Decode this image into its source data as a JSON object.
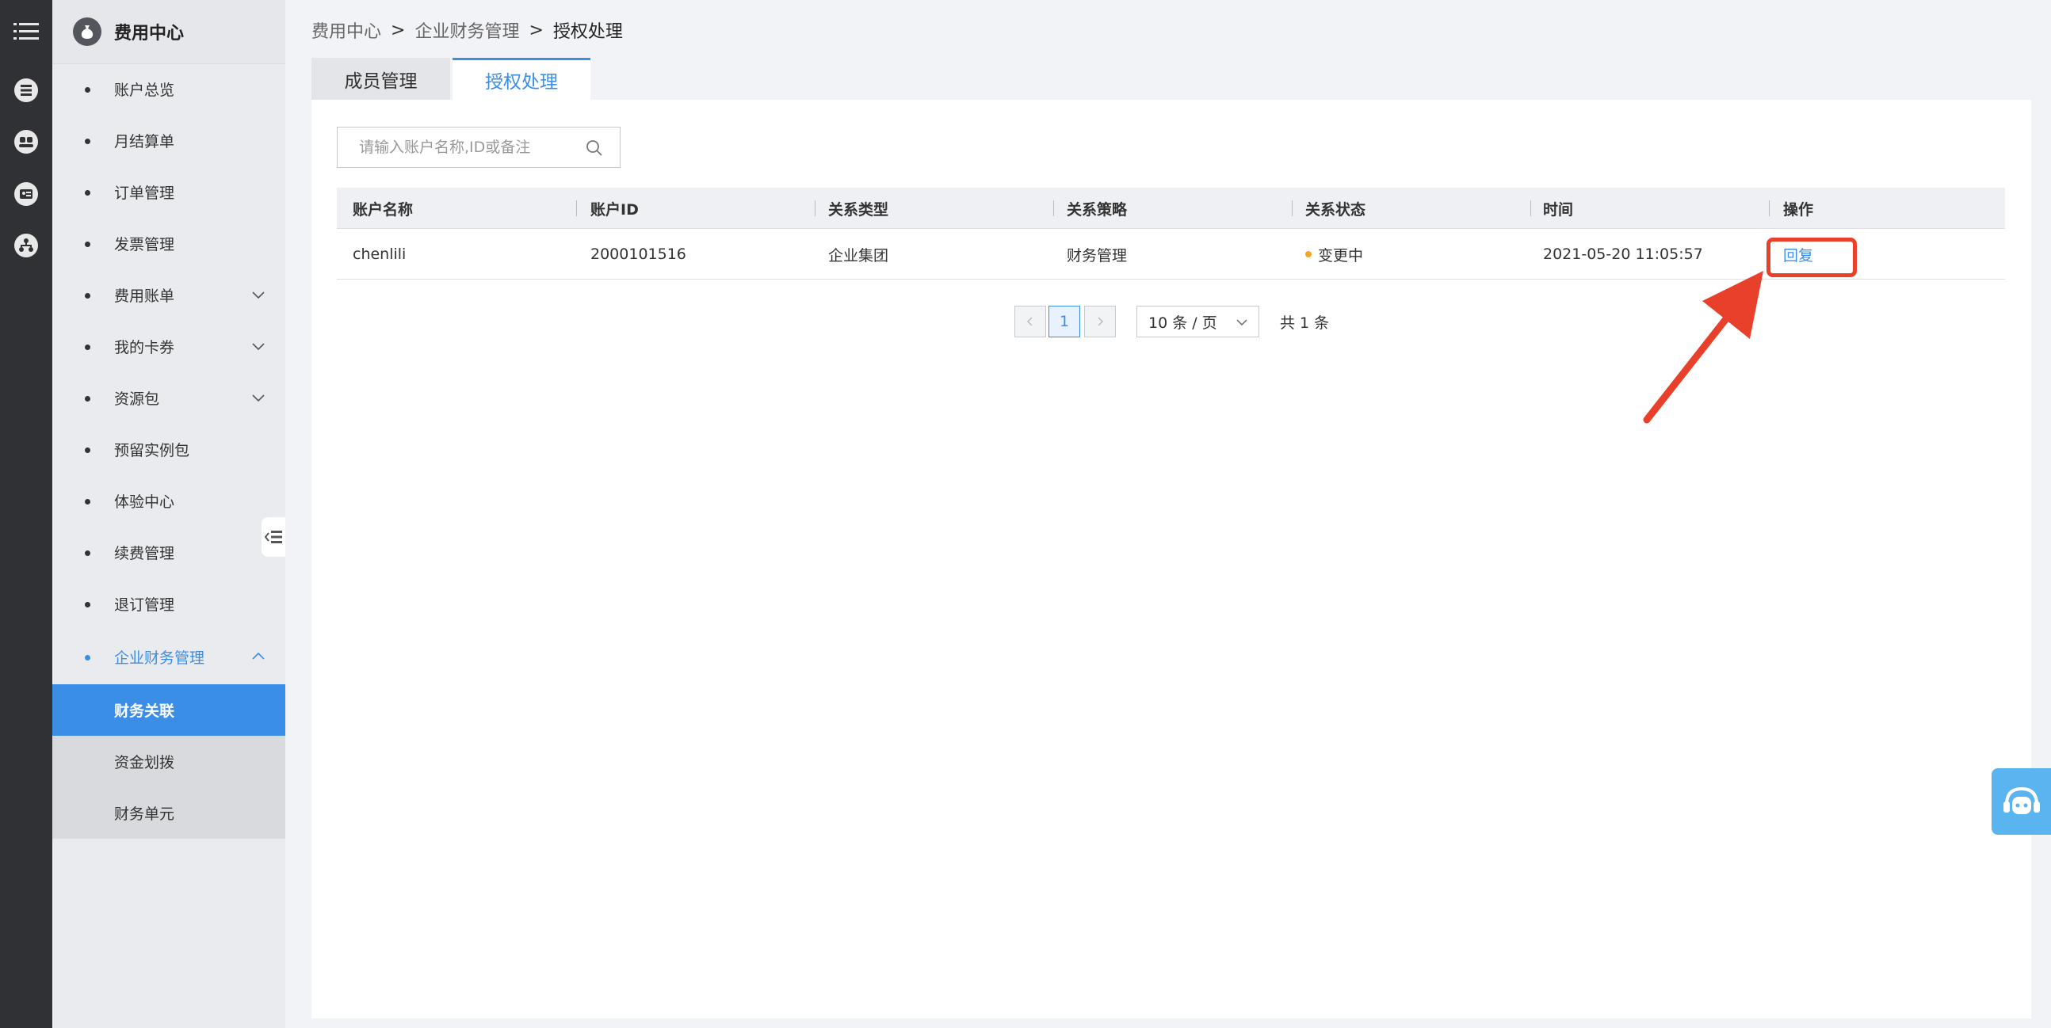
{
  "sidebar": {
    "title": "费用中心",
    "items": [
      {
        "label": "账户总览"
      },
      {
        "label": "月结算单"
      },
      {
        "label": "订单管理"
      },
      {
        "label": "发票管理"
      },
      {
        "label": "费用账单"
      },
      {
        "label": "我的卡券"
      },
      {
        "label": "资源包"
      },
      {
        "label": "预留实例包"
      },
      {
        "label": "体验中心"
      },
      {
        "label": "续费管理"
      },
      {
        "label": "退订管理"
      },
      {
        "label": "企业财务管理"
      }
    ],
    "subitems": [
      {
        "label": "财务关联"
      },
      {
        "label": "资金划拨"
      },
      {
        "label": "财务单元"
      }
    ]
  },
  "breadcrumb": {
    "level1": "费用中心",
    "level2": "企业财务管理",
    "current": "授权处理",
    "separator": ">"
  },
  "tabs": {
    "members": "成员管理",
    "auth": "授权处理"
  },
  "search": {
    "placeholder": "请输入账户名称,ID或备注",
    "value": ""
  },
  "table": {
    "headers": {
      "name": "账户名称",
      "id": "账户ID",
      "type": "关系类型",
      "policy": "关系策略",
      "status": "关系状态",
      "time": "时间",
      "action": "操作"
    },
    "rows": [
      {
        "name": "chenlili",
        "id": "2000101516",
        "type": "企业集团",
        "policy": "财务管理",
        "status": "变更中",
        "time": "2021-05-20 11:05:57",
        "action": "回复"
      }
    ]
  },
  "pagination": {
    "current": "1",
    "page_size": "10 条 / 页",
    "total": "共 1 条"
  },
  "colors": {
    "accent": "#3a8ee6",
    "status_pending": "#f5a623",
    "annotation": "#e8402b"
  }
}
